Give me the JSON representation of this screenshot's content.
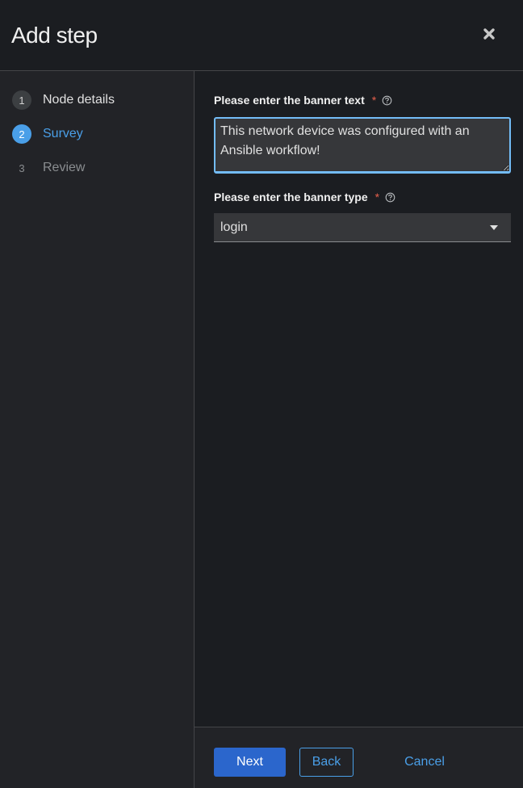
{
  "header": {
    "title": "Add step",
    "close_icon": "close-icon"
  },
  "wizard_nav": {
    "steps": [
      {
        "number": "1",
        "label": "Node details",
        "state": "done"
      },
      {
        "number": "2",
        "label": "Survey",
        "state": "current"
      },
      {
        "number": "3",
        "label": "Review",
        "state": "pending"
      }
    ]
  },
  "form": {
    "banner_text": {
      "label": "Please enter the banner text",
      "required_marker": "*",
      "help_icon": "help-circle-icon",
      "value": "This network device was configured with an Ansible workflow!"
    },
    "banner_type": {
      "label": "Please enter the banner type",
      "required_marker": "*",
      "help_icon": "help-circle-icon",
      "selected": "login",
      "caret_icon": "caret-down-icon"
    }
  },
  "footer": {
    "next_label": "Next",
    "back_label": "Back",
    "cancel_label": "Cancel"
  },
  "colors": {
    "accent": "#4a9fe8",
    "primary_button": "#2b66cc",
    "required": "#e8604c",
    "background": "#1b1d21",
    "nav_background": "#222327"
  }
}
